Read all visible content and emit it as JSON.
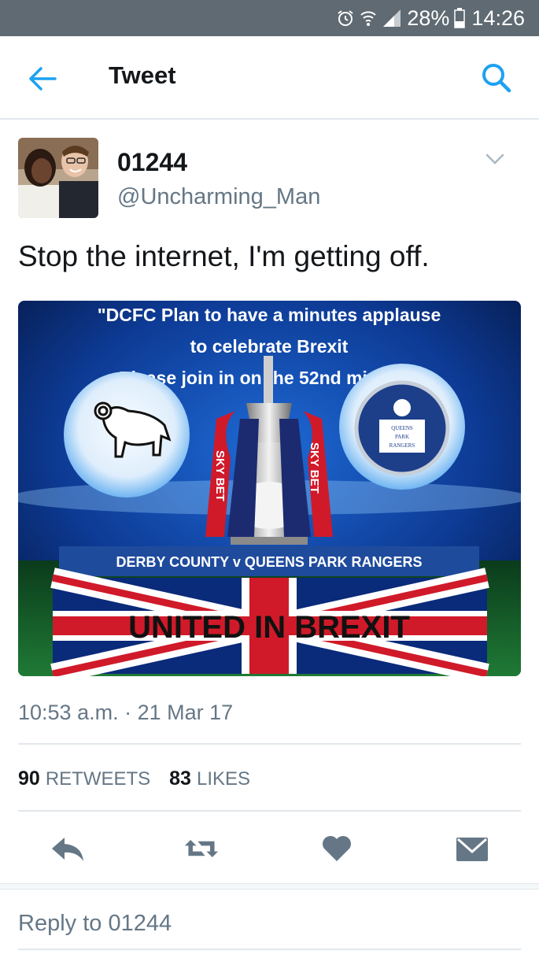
{
  "status_bar": {
    "icons": [
      "alarm-icon",
      "wifi-icon",
      "cell-signal-icon",
      "battery-icon"
    ],
    "battery": "28%",
    "time": "14:26"
  },
  "header": {
    "title": "Tweet",
    "back_icon": "back-arrow-icon",
    "search_icon": "search-icon",
    "accent_color": "#1da1f2"
  },
  "tweet": {
    "display_name": "01244",
    "handle": "@Uncharming_Man",
    "text": "Stop the internet, I'm getting off.",
    "media": {
      "quote_line1": "\"DCFC Plan to have a minutes applause",
      "quote_line2": "to celebrate Brexit",
      "quote_line3": "Please join in on the 52nd minute.\"",
      "crest_text": [
        "QUEENS",
        "PARK",
        "RANGERS"
      ],
      "sponsor_text": "SKY BET",
      "match_banner": "DERBY COUNTY v QUEENS PARK RANGERS",
      "slogan": "UNITED IN BREXIT"
    },
    "timestamp": "10:53 a.m. · 21 Mar 17",
    "retweets_count": "90",
    "retweets_label": "RETWEETS",
    "likes_count": "83",
    "likes_label": "LIKES"
  },
  "actions": {
    "icons": [
      "reply-icon",
      "retweet-icon",
      "like-icon",
      "direct-message-icon"
    ],
    "icon_color": "#657786"
  },
  "reply_box": {
    "placeholder": "Reply to 01244"
  }
}
